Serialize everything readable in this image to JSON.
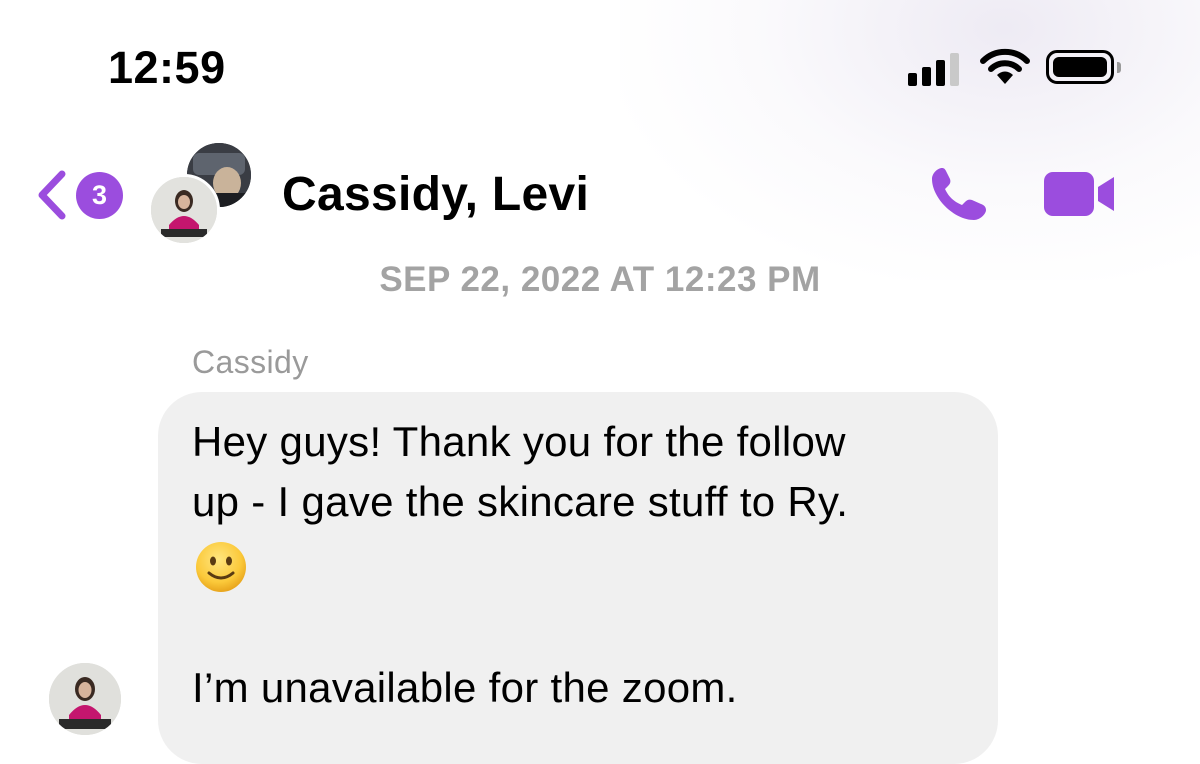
{
  "status_bar": {
    "time": "12:59",
    "signal_bars_active": 3,
    "signal_bars_total": 4,
    "wifi_icon": "wifi-icon",
    "battery_icon": "battery-full-icon"
  },
  "header": {
    "back_icon": "chevron-left-icon",
    "unread_count": "3",
    "conversation_title": "Cassidy, Levi",
    "call_icon": "phone-icon",
    "video_icon": "video-camera-icon",
    "accent_color": "#9b4dde"
  },
  "thread": {
    "timestamp": "SEP 22, 2022 AT 12:23 PM",
    "messages": [
      {
        "sender": "Cassidy",
        "lines": [
          "Hey guys! Thank you for the follow",
          "up - I gave the skincare stuff to Ry.",
          "I’m unavailable for the zoom."
        ],
        "emoji_icon": "slightly-smiling-face-icon"
      }
    ]
  }
}
